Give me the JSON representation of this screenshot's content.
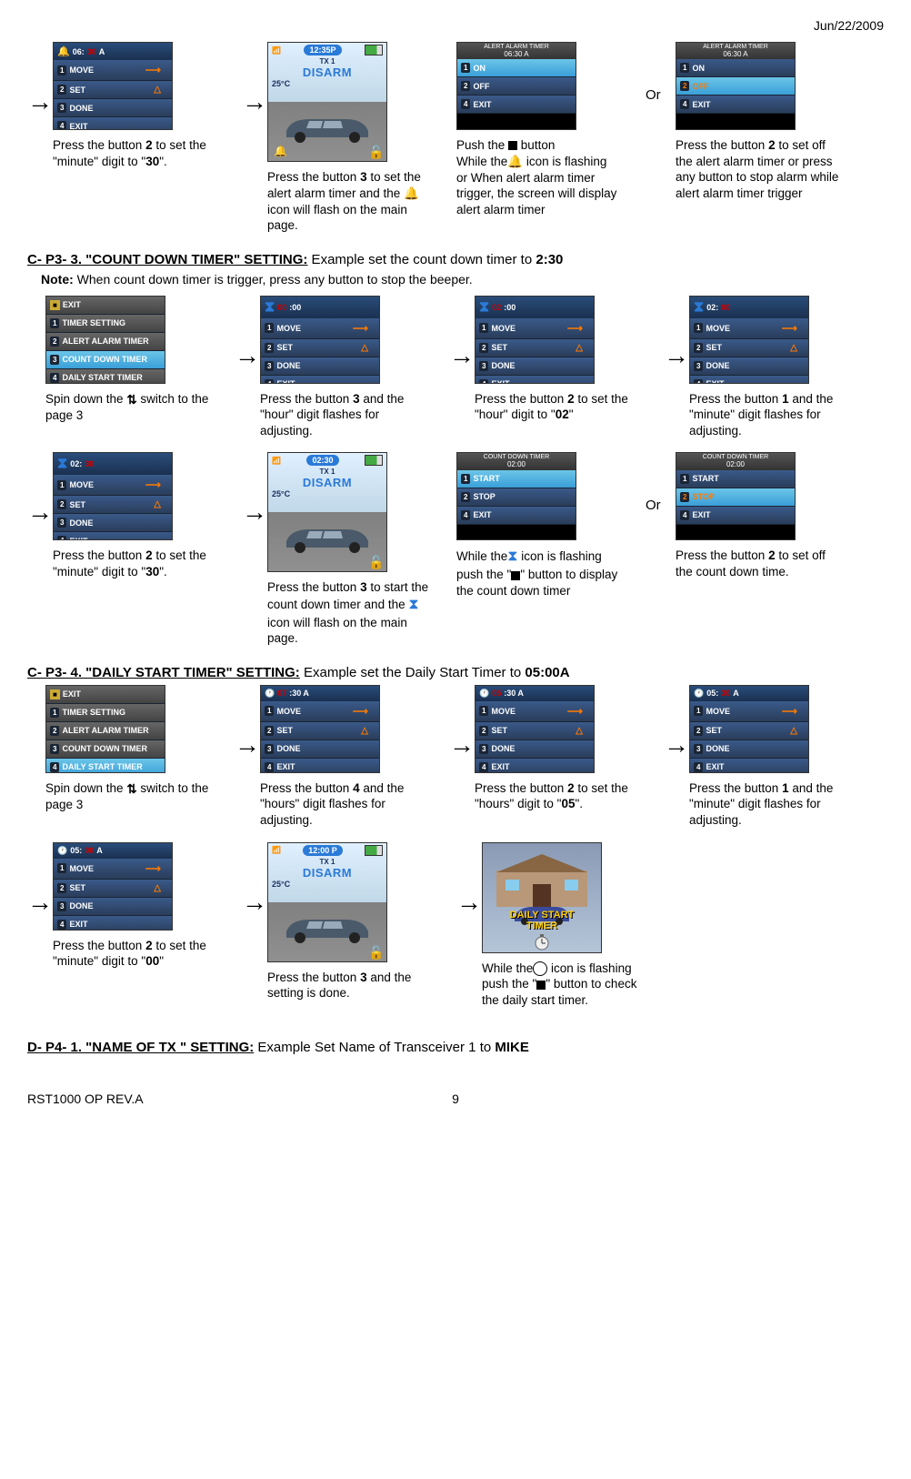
{
  "doc": {
    "date": "Jun/22/2009",
    "footer_left": "RST1000 OP REV.A",
    "page_number": "9"
  },
  "row1": {
    "s1": {
      "header_time": "06:30 A",
      "menu": [
        "MOVE",
        "SET",
        "DONE",
        "EXIT"
      ],
      "desc_pre": "Press the button ",
      "desc_b": "2",
      "desc_post": " to set the \"minute\" digit to \"",
      "desc_b2": "30",
      "desc_end": "\"."
    },
    "s2": {
      "time": "12:35P",
      "tx": "TX 1",
      "disarm": "DISARM",
      "temp": "25°C",
      "desc": "Press the button 3 to set the alert alarm timer and the  icon will flash on the main page."
    },
    "s3": {
      "header1": "ALERT ALARM TIMER",
      "header2": "06:30 A",
      "menu": [
        {
          "n": "1",
          "t": "ON",
          "hl": true
        },
        {
          "n": "2",
          "t": "OFF"
        },
        {
          "n": "4",
          "t": "EXIT"
        }
      ],
      "desc": "Push the  ■  button\nWhile the icon is flashing or When alert alarm timer trigger, the screen will display alert alarm timer"
    },
    "or": "Or",
    "s4": {
      "header1": "ALERT ALARM TIMER",
      "header2": "06:30 A",
      "menu": [
        {
          "n": "1",
          "t": "ON"
        },
        {
          "n": "2",
          "t": "OFF",
          "hl": true,
          "orange": true
        },
        {
          "n": "4",
          "t": "EXIT"
        }
      ],
      "desc": "Press the button 2 to set off the alert alarm timer or press any button to stop alarm while alert alarm timer trigger"
    }
  },
  "section_c3": {
    "heading_u": "C- P3- 3. \"COUNT DOWN TIMER\" SETTING:",
    "heading_rest": "   Example set the count down timer to ",
    "heading_b": "2:30",
    "note_b": "Note:",
    "note": " When count down timer is trigger, press any button to stop the beeper."
  },
  "c3_row1": {
    "s1": {
      "menu_header": "EXIT",
      "menu": [
        "TIMER SETTING",
        "ALERT ALARM TIMER",
        "COUNT DOWN TIMER",
        "DAILY START TIMER"
      ],
      "desc": "Spin down the  switch to the page 3"
    },
    "s2": {
      "header_time": "00:00",
      "menu": [
        "MOVE",
        "SET",
        "DONE",
        "EXIT"
      ],
      "desc": "Press the button 3 and the \"hour\" digit flashes for adjusting."
    },
    "s3": {
      "header_time": "02:00",
      "menu": [
        "MOVE",
        "SET",
        "DONE",
        "EXIT"
      ],
      "desc": "Press the button 2 to set the \"hour\" digit to \"02\""
    },
    "s4": {
      "header_time": "02:00",
      "menu": [
        "MOVE",
        "SET",
        "DONE",
        "EXIT"
      ],
      "desc": "Press the button 1 and the \"minute\" digit flashes for adjusting."
    }
  },
  "c3_row2": {
    "s1": {
      "header_time": "02:30",
      "menu": [
        "MOVE",
        "SET",
        "DONE",
        "EXIT"
      ],
      "desc": "Press the button 2 to set the \"minute\" digit to \"30\"."
    },
    "s2": {
      "time": "02:30",
      "tx": "TX 1",
      "disarm": "DISARM",
      "temp": "25°C",
      "desc": "Press the button 3 to start the count down timer and the  icon will flash on the main page."
    },
    "s3": {
      "header1": "COUNT DOWN TIMER",
      "header2": "02:00",
      "menu": [
        {
          "n": "1",
          "t": "START",
          "hl": true
        },
        {
          "n": "2",
          "t": "STOP"
        },
        {
          "n": "4",
          "t": "EXIT"
        }
      ],
      "desc": "While the icon is flashing push the \"■\" button to display the count down timer"
    },
    "or": "Or",
    "s4": {
      "header1": "COUNT DOWN TIMER",
      "header2": "02:00",
      "menu": [
        {
          "n": "1",
          "t": "START"
        },
        {
          "n": "2",
          "t": "STOP",
          "hl": true,
          "orange": true
        },
        {
          "n": "4",
          "t": "EXIT"
        }
      ],
      "desc": "Press the button 2 to set off the count down time."
    }
  },
  "section_c4": {
    "heading_u": "C- P3- 4. \"DAILY START TIMER\" SETTING:",
    "heading_rest": "   Example set the Daily Start Timer to ",
    "heading_b": "05:00A"
  },
  "c4_row1": {
    "s1": {
      "menu_header": "EXIT",
      "menu": [
        "TIMER SETTING",
        "ALERT ALARM TIMER",
        "COUNT DOWN TIMER",
        "DAILY START TIMER"
      ],
      "desc": "Spin down the  switch to the page 3"
    },
    "s2": {
      "header_time": "07:30 A",
      "menu": [
        "MOVE",
        "SET",
        "DONE",
        "EXIT"
      ],
      "desc": "Press the button 4 and the \"hours\" digit flashes for adjusting."
    },
    "s3": {
      "header_time": "05:30 A",
      "menu": [
        "MOVE",
        "SET",
        "DONE",
        "EXIT"
      ],
      "desc": "Press the button 2 to set the \"hours\" digit to \"05\"."
    },
    "s4": {
      "header_time": "05:30 A",
      "menu": [
        "MOVE",
        "SET",
        "DONE",
        "EXIT"
      ],
      "desc": "Press the button 1 and the \"minute\" digit flashes for adjusting."
    }
  },
  "c4_row2": {
    "s1": {
      "header_time": "05:00 A",
      "menu": [
        "MOVE",
        "SET",
        "DONE",
        "EXIT"
      ],
      "desc": "Press the button 2 to set the \"minute\" digit to \"00\""
    },
    "s2": {
      "time": "12:00 P",
      "tx": "TX 1",
      "disarm": "DISARM",
      "temp": "25°C",
      "desc": "Press the button 3 and the setting is done."
    },
    "s3": {
      "banner": "DAILY START\nTIMER",
      "desc": "While the icon is flashing push the \"■\" button to check the daily start timer."
    }
  },
  "section_d1": {
    "heading_u": "D- P4- 1. \"NAME OF TX \" SETTING:",
    "heading_rest": "   Example Set Name of Transceiver 1 to ",
    "heading_b": "MIKE"
  }
}
